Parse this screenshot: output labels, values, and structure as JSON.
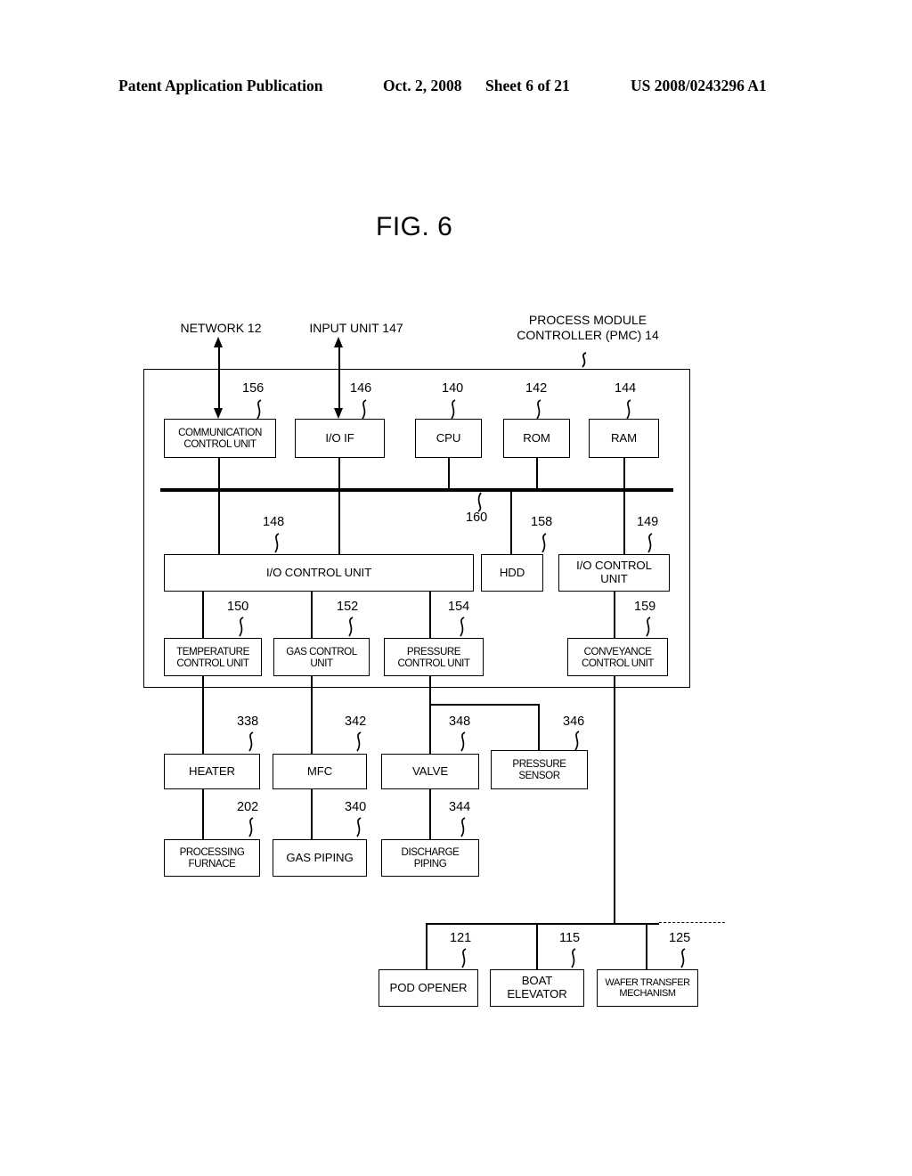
{
  "header": {
    "publication": "Patent Application Publication",
    "date": "Oct. 2, 2008",
    "sheet": "Sheet 6 of 21",
    "number": "US 2008/0243296 A1"
  },
  "figure": {
    "title": "FIG. 6"
  },
  "top_labels": {
    "network": "NETWORK 12",
    "input_unit": "INPUT UNIT 147",
    "pmc": "PROCESS MODULE\nCONTROLLER (PMC) 14"
  },
  "blocks": {
    "communication_control_unit": {
      "label": "COMMUNICATION\nCONTROL UNIT",
      "ref": "156"
    },
    "io_if": {
      "label": "I/O IF",
      "ref": "146"
    },
    "cpu": {
      "label": "CPU",
      "ref": "140"
    },
    "rom": {
      "label": "ROM",
      "ref": "142"
    },
    "ram": {
      "label": "RAM",
      "ref": "144"
    },
    "bus": {
      "label": "",
      "ref": "160"
    },
    "io_control_unit_148": {
      "label": "I/O CONTROL UNIT",
      "ref": "148"
    },
    "hdd": {
      "label": "HDD",
      "ref": "158"
    },
    "io_control_unit_149": {
      "label": "I/O CONTROL\nUNIT",
      "ref": "149"
    },
    "temperature_control_unit": {
      "label": "TEMPERATURE\nCONTROL UNIT",
      "ref": "150"
    },
    "gas_control_unit": {
      "label": "GAS CONTROL\nUNIT",
      "ref": "152"
    },
    "pressure_control_unit": {
      "label": "PRESSURE\nCONTROL UNIT",
      "ref": "154"
    },
    "conveyance_control_unit": {
      "label": "CONVEYANCE\nCONTROL UNIT",
      "ref": "159"
    },
    "heater": {
      "label": "HEATER",
      "ref": "338"
    },
    "mfc": {
      "label": "MFC",
      "ref": "342"
    },
    "valve": {
      "label": "VALVE",
      "ref": "348"
    },
    "pressure_sensor": {
      "label": "PRESSURE\nSENSOR",
      "ref": "346"
    },
    "processing_furnace": {
      "label": "PROCESSING\nFURNACE",
      "ref": "202"
    },
    "gas_piping": {
      "label": "GAS PIPING",
      "ref": "340"
    },
    "discharge_piping": {
      "label": "DISCHARGE\nPIPING",
      "ref": "344"
    },
    "pod_opener": {
      "label": "POD OPENER",
      "ref": "121"
    },
    "boat_elevator": {
      "label": "BOAT\nELEVATOR",
      "ref": "115"
    },
    "wafer_transfer_mechanism": {
      "label": "WAFER TRANSFER\nMECHANISM",
      "ref": "125"
    }
  }
}
